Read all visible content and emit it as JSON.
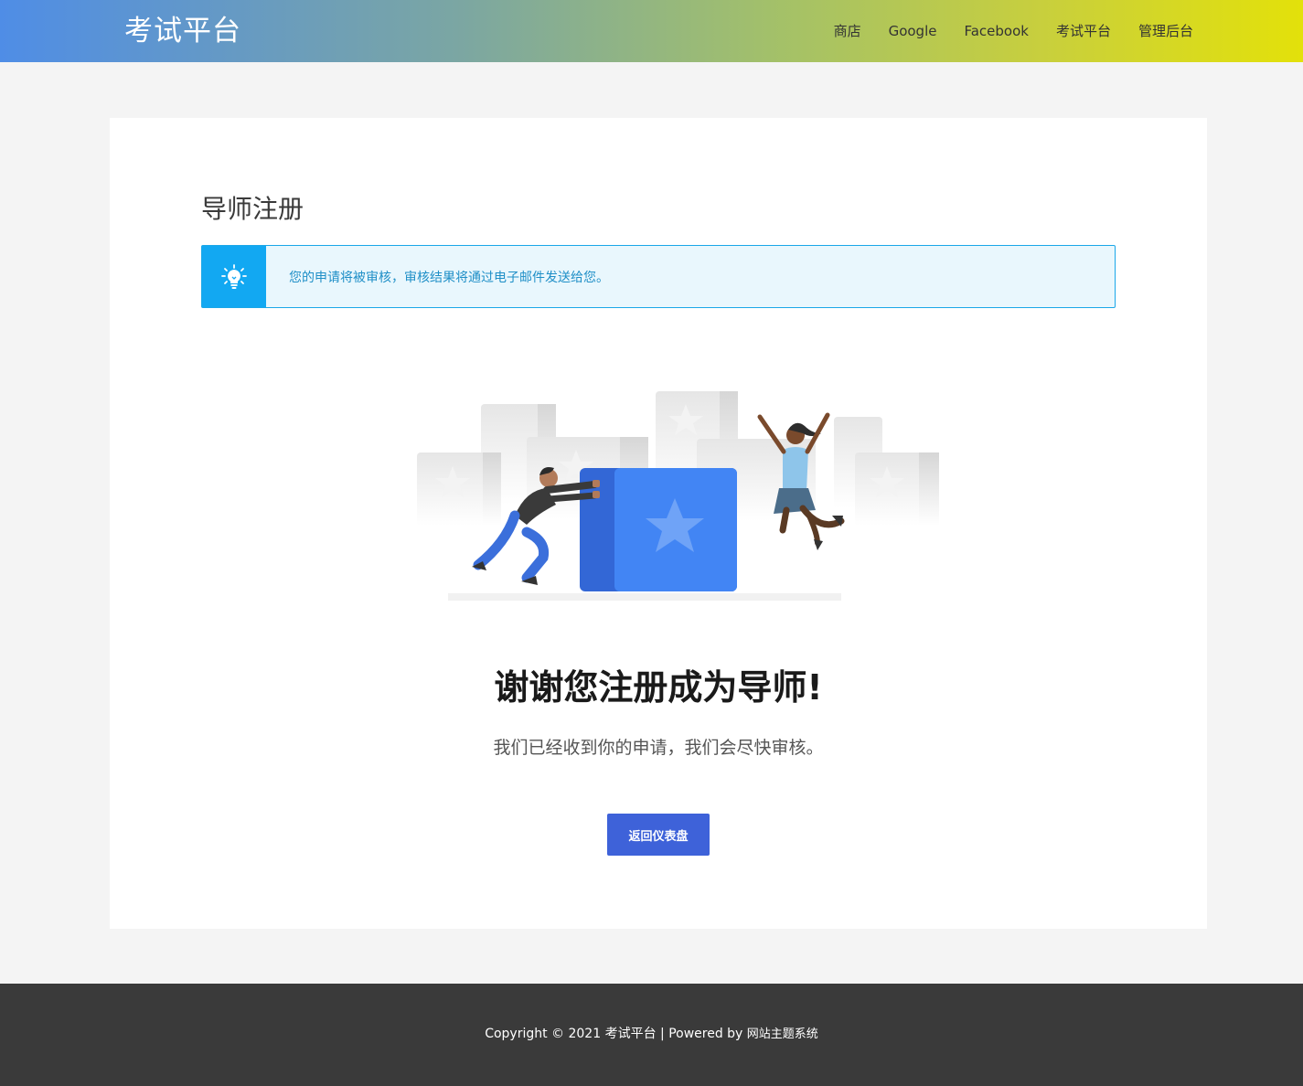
{
  "header": {
    "site_title": "考试平台",
    "nav": [
      "商店",
      "Google",
      "Facebook",
      "考试平台",
      "管理后台"
    ]
  },
  "main": {
    "page_title": "导师注册",
    "notice": {
      "icon": "lightbulb-icon",
      "text": "您的申请将被审核，审核结果将通过电子邮件发送给您。"
    },
    "illustration": "people-pushing-star-box-illustration",
    "thanks_heading": "谢谢您注册成为导师!",
    "subtext": "我们已经收到你的申请，我们会尽快审核。",
    "button_label": "返回仪表盘"
  },
  "footer": {
    "copyright": "Copyright © 2021 考试平台 | Powered by",
    "powered_link": "网站主题系统"
  },
  "colors": {
    "accent": "#3e62d9",
    "notice_blue": "#12a8f2",
    "footer_bg": "#3a3a3a"
  }
}
